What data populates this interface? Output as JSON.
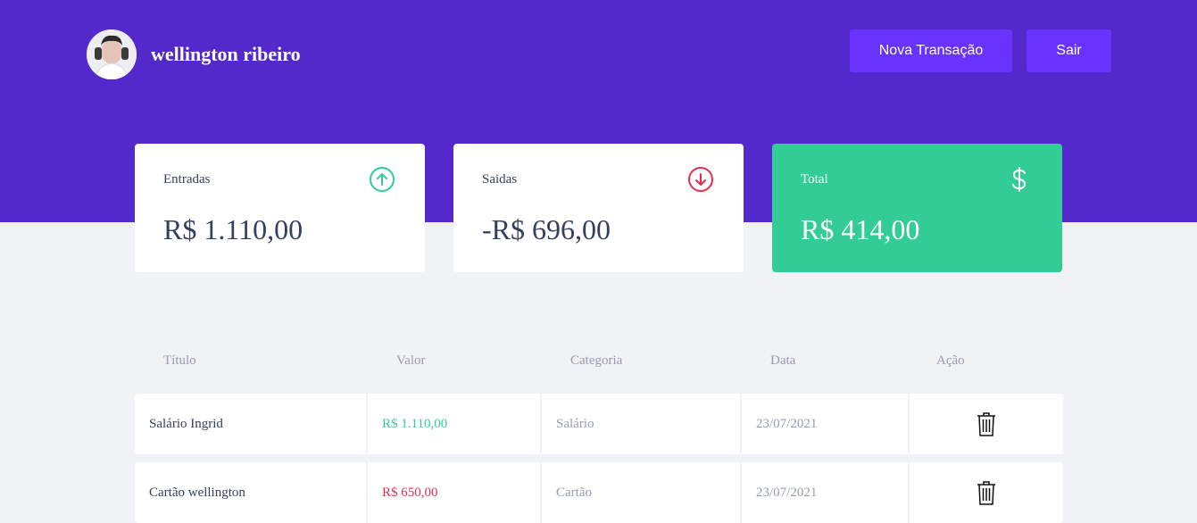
{
  "user": {
    "name": "wellington ribeiro",
    "avatar_icon": "user-avatar"
  },
  "header": {
    "new_transaction_label": "Nova Transação",
    "logout_label": "Sair"
  },
  "summary": {
    "income": {
      "label": "Entradas",
      "value": "R$ 1.110,00",
      "icon": "arrow-up-circle-icon"
    },
    "outcome": {
      "label": "Saidas",
      "value": "-R$ 696,00",
      "icon": "arrow-down-circle-icon"
    },
    "total": {
      "label": "Total",
      "value": "R$ 414,00",
      "icon": "dollar-icon"
    }
  },
  "table": {
    "headers": [
      "Título",
      "Valor",
      "Categoria",
      "Data",
      "Ação"
    ],
    "rows": [
      {
        "title": "Salário Ingrid",
        "amount": "R$ 1.110,00",
        "type": "deposit",
        "category": "Salário",
        "date": "23/07/2021"
      },
      {
        "title": "Cartão wellington",
        "amount": "R$ 650,00",
        "type": "withdraw",
        "category": "Cartão",
        "date": "23/07/2021"
      }
    ]
  },
  "colors": {
    "header_bg": "#5429cc",
    "button_bg": "#6933ff",
    "green": "#33cc95",
    "red": "#e52e4d",
    "text": "#363f5f",
    "text_muted": "#969cb2",
    "page_bg": "#f0f2f5"
  }
}
